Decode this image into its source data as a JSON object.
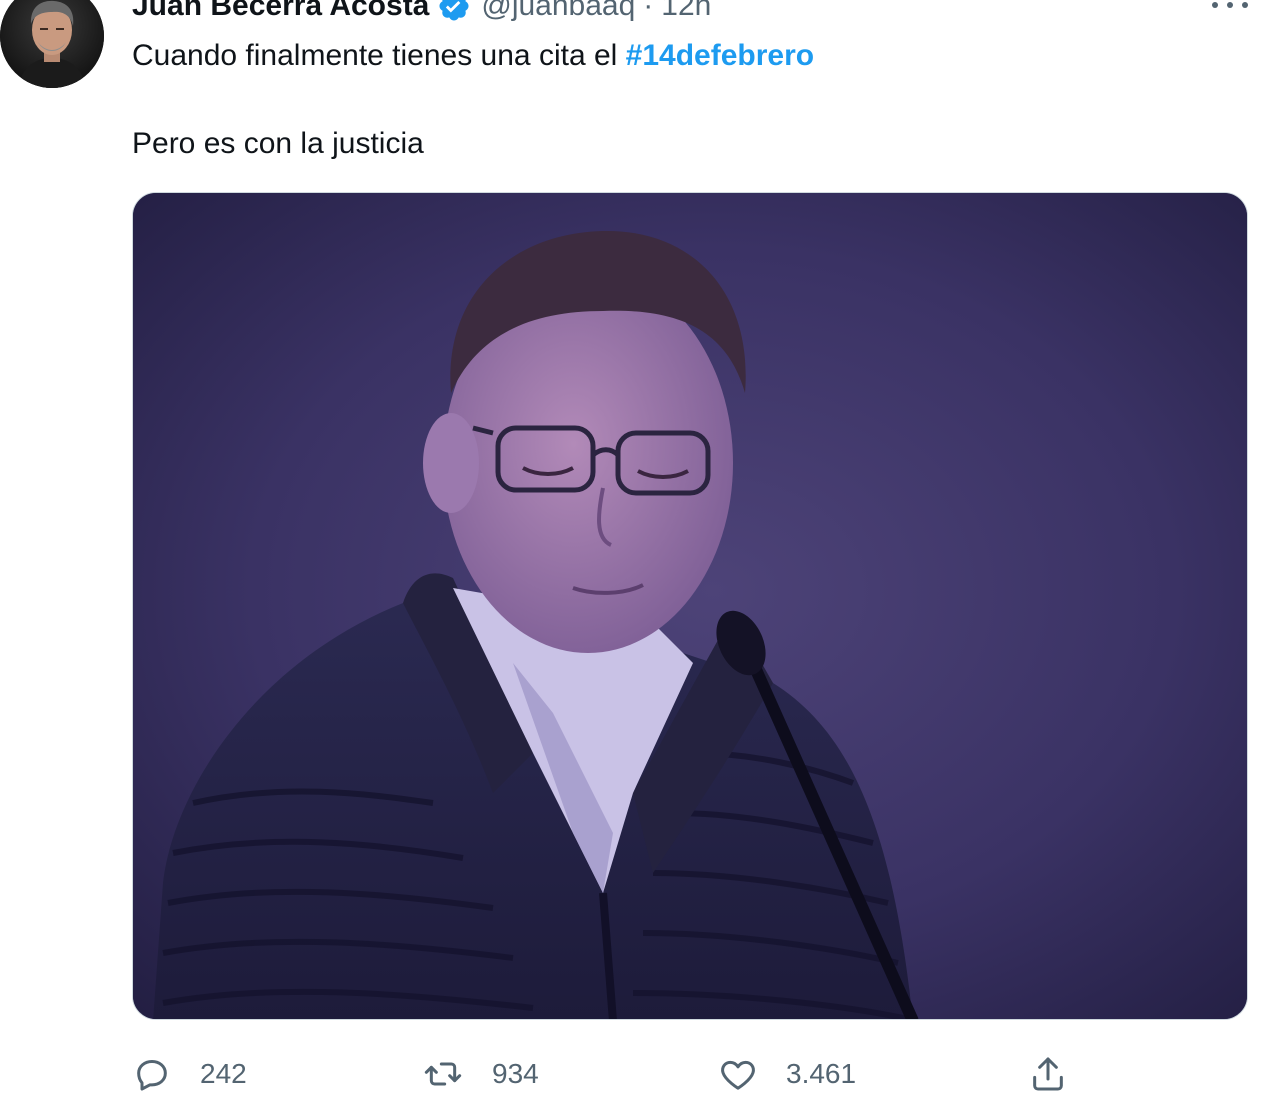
{
  "tweet": {
    "author": {
      "display_name": "Juan Becerra Acosta",
      "handle": "@juanbaaq",
      "verified": true,
      "avatar_icon": "profile-photo-icon"
    },
    "separator": "·",
    "time": "12h",
    "text_line1": "Cuando finalmente tienes una cita el ",
    "hashtag": "#14defebrero",
    "text_line2": "Pero es con la justicia",
    "media": {
      "type": "photo",
      "icon": "photo-icon"
    },
    "actions": {
      "reply_count": "242",
      "retweet_count": "934",
      "like_count": "3.461"
    }
  },
  "colors": {
    "link": "#1d9bf0",
    "secondary_text": "#536471",
    "primary_text": "#0f1419",
    "border": "#cfd9de"
  }
}
